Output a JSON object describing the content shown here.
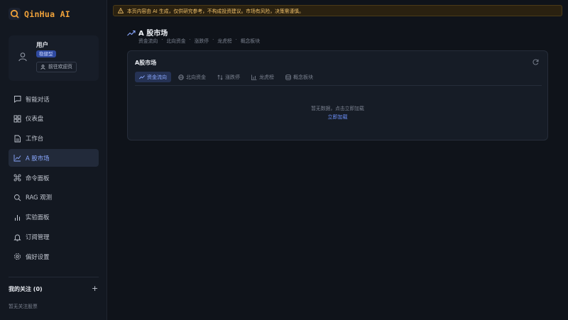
{
  "app": {
    "title": "QinHua AI",
    "accent": "#f0a23a",
    "nav_active": "#8aa8ff"
  },
  "user": {
    "name": "用户",
    "badge": "稳健型",
    "home_label": "前往欢迎页"
  },
  "nav": [
    {
      "label": "智能对话",
      "icon": "chat-icon"
    },
    {
      "label": "仪表盘",
      "icon": "dashboard-icon"
    },
    {
      "label": "工作台",
      "icon": "document-icon"
    },
    {
      "label": "A 股市场",
      "icon": "chart-line-icon",
      "active": true
    },
    {
      "label": "命令面板",
      "icon": "command-icon"
    },
    {
      "label": "RAG 观测",
      "icon": "search-icon"
    },
    {
      "label": "实验面板",
      "icon": "bar-chart-icon"
    },
    {
      "label": "订阅管理",
      "icon": "bell-icon"
    },
    {
      "label": "偏好设置",
      "icon": "gear-icon"
    }
  ],
  "watchlist": {
    "title": "我的关注 (0)",
    "add": "+",
    "empty": "暂无关注股票"
  },
  "banner": {
    "text": "本页内容由 AI 生成，仅供研究参考，不构成投资建议。市场有风险，决策需谨慎。"
  },
  "page": {
    "title": "A 股市场",
    "breadcrumbs": [
      "资金流向",
      "·",
      "北向资金",
      "·",
      "涨跌停",
      "·",
      "龙虎榜",
      "·",
      "概念板块"
    ]
  },
  "card": {
    "title": "A股市场",
    "tabs": [
      {
        "label": "资金流向",
        "icon": "trend-icon",
        "active": true
      },
      {
        "label": "北向资金",
        "icon": "globe-icon"
      },
      {
        "label": "涨跌停",
        "icon": "updown-icon"
      },
      {
        "label": "龙虎榜",
        "icon": "bar-chart-icon"
      },
      {
        "label": "概念板块",
        "icon": "layers-icon"
      }
    ],
    "empty": "暂无数据，点击立即加载",
    "load": "立即加载"
  }
}
